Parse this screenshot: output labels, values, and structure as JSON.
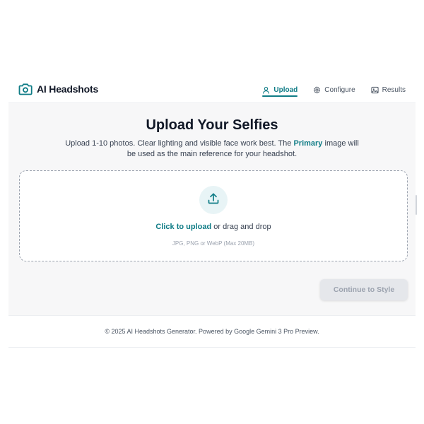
{
  "brand": {
    "title": "AI Headshots",
    "icon": "camera-icon"
  },
  "nav": {
    "items": [
      {
        "label": "Upload",
        "icon": "user-icon",
        "active": true
      },
      {
        "label": "Configure",
        "icon": "gear-icon",
        "active": false
      },
      {
        "label": "Results",
        "icon": "image-icon",
        "active": false
      }
    ]
  },
  "main": {
    "title": "Upload Your Selfies",
    "subtitle_before": "Upload 1-10 photos. Clear lighting and visible face work best. The ",
    "subtitle_highlight": "Primary",
    "subtitle_after": " image will be used as the main reference for your headshot.",
    "dropzone": {
      "link": "Click to upload",
      "text": " or drag and drop",
      "hint": "JPG, PNG or WebP (Max 20MB)",
      "icon": "upload-icon"
    },
    "continue_label": "Continue to Style"
  },
  "footer": {
    "text": "© 2025 AI Headshots Generator. Powered by Google Gemini 3 Pro Preview."
  },
  "colors": {
    "accent": "#0f7c86",
    "background": "#f7f7f8",
    "disabled_button": "#e5e7eb"
  }
}
